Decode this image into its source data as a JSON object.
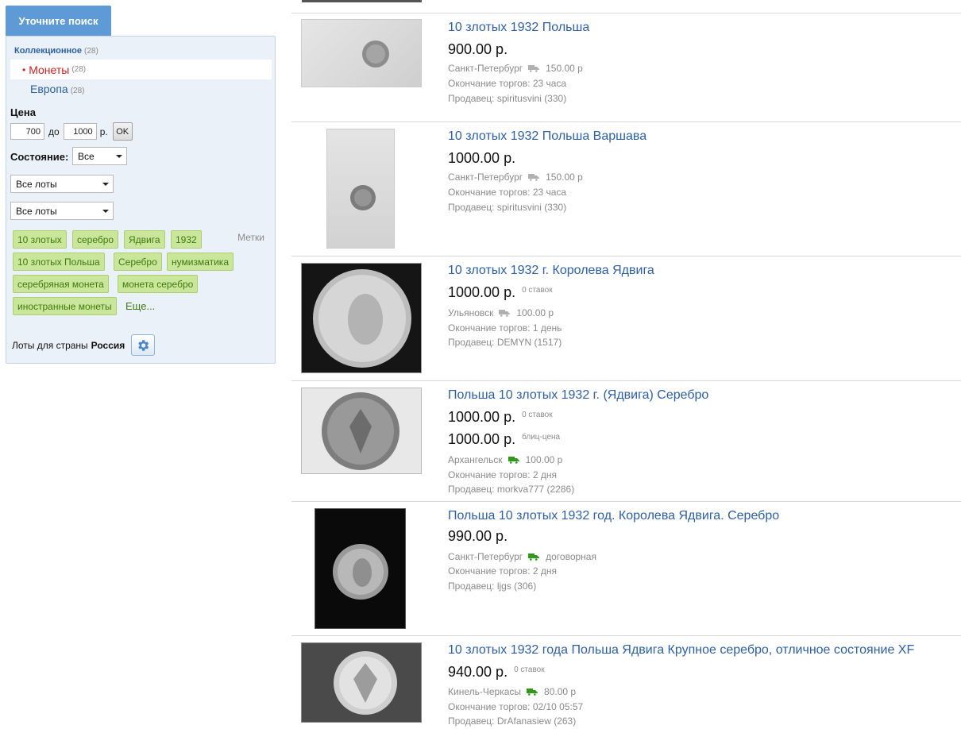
{
  "sidebar": {
    "refine_title": "Уточните поиск",
    "category_root": {
      "label": "Коллекционное",
      "count": "(28)"
    },
    "category_selected": {
      "bullet": "•",
      "label": "Монеты",
      "count": "(28)"
    },
    "category_sub": {
      "label": "Европа",
      "count": "(28)"
    },
    "price": {
      "label": "Цена",
      "from": "700",
      "sep": "до",
      "to": "1000",
      "currency": "р.",
      "ok_label": "OK"
    },
    "condition": {
      "label": "Состояние:",
      "value": "Все"
    },
    "lot_filters": [
      "Все лоты",
      "Все лоты"
    ],
    "tags_label": "Метки",
    "tags": [
      "10 злотых",
      "серебро",
      "Ядвига",
      "1932",
      "10 злотых Польша",
      "Серебро",
      "нумизматика",
      "серебряная монета",
      "монета серебро",
      "иностранные монеты"
    ],
    "tags_more": "Еще...",
    "country": {
      "prefix": "Лоты для страны",
      "name": "Россия"
    }
  },
  "colors": {
    "link": "#2b5fa8",
    "selected": "#d0201c",
    "tag_bg": "#c9e69a",
    "tag_text": "#3e7a10",
    "truck_gray": "#b0b0b0",
    "truck_green": "#2f9a1a"
  },
  "lots": [
    {
      "title": "10 злотых 1932 Польша",
      "prices": [
        {
          "value": "900.00 р.",
          "note": ""
        }
      ],
      "city": "Санкт-Петербург",
      "truck": "gray",
      "shipping": "150.00 р",
      "ends": "Окончание торгов: 23 часа",
      "seller": "Продавец: spiritusvini (330)"
    },
    {
      "title": "10 злотых 1932 Польша Варшава",
      "prices": [
        {
          "value": "1000.00 р.",
          "note": ""
        }
      ],
      "city": "Санкт-Петербург",
      "truck": "gray",
      "shipping": "150.00 р",
      "ends": "Окончание торгов: 23 часа",
      "seller": "Продавец: spiritusvini (330)"
    },
    {
      "title": "10 злотых 1932 г. Королева Ядвига",
      "prices": [
        {
          "value": "1000.00 р.",
          "note": "0 ставок"
        }
      ],
      "city": "Ульяновск",
      "truck": "gray",
      "shipping": "100.00 р",
      "ends": "Окончание торгов: 1 день",
      "seller": "Продавец: DEMYN (1517)"
    },
    {
      "title": "Польша 10 злотых 1932 г. (Ядвига) Серебро",
      "prices": [
        {
          "value": "1000.00 р.",
          "note": "0 ставок"
        },
        {
          "value": "1000.00 р.",
          "note": "блиц-цена"
        }
      ],
      "city": "Архангельск",
      "truck": "green",
      "shipping": "100.00 р",
      "ends": "Окончание торгов: 2 дня",
      "seller": "Продавец: morkva777 (2286)"
    },
    {
      "title": "Польша 10 злотых 1932 год. Королева Ядвига. Серебро",
      "prices": [
        {
          "value": "990.00 р.",
          "note": ""
        }
      ],
      "city": "Санкт-Петербург",
      "truck": "green",
      "shipping": "договорная",
      "ends": "Окончание торгов: 2 дня",
      "seller": "Продавец: ljgs (306)"
    },
    {
      "title": "10 злотых 1932 года Польша Ядвига Крупное серебро, отличное состояние XF",
      "prices": [
        {
          "value": "940.00 р.",
          "note": "0 ставок"
        }
      ],
      "city": "Кинель-Черкасы",
      "truck": "green",
      "shipping": "80.00 р",
      "ends": "Окончание торгов: 02/10 05:57",
      "seller": "Продавец: DrAfanasiew (263)"
    }
  ]
}
